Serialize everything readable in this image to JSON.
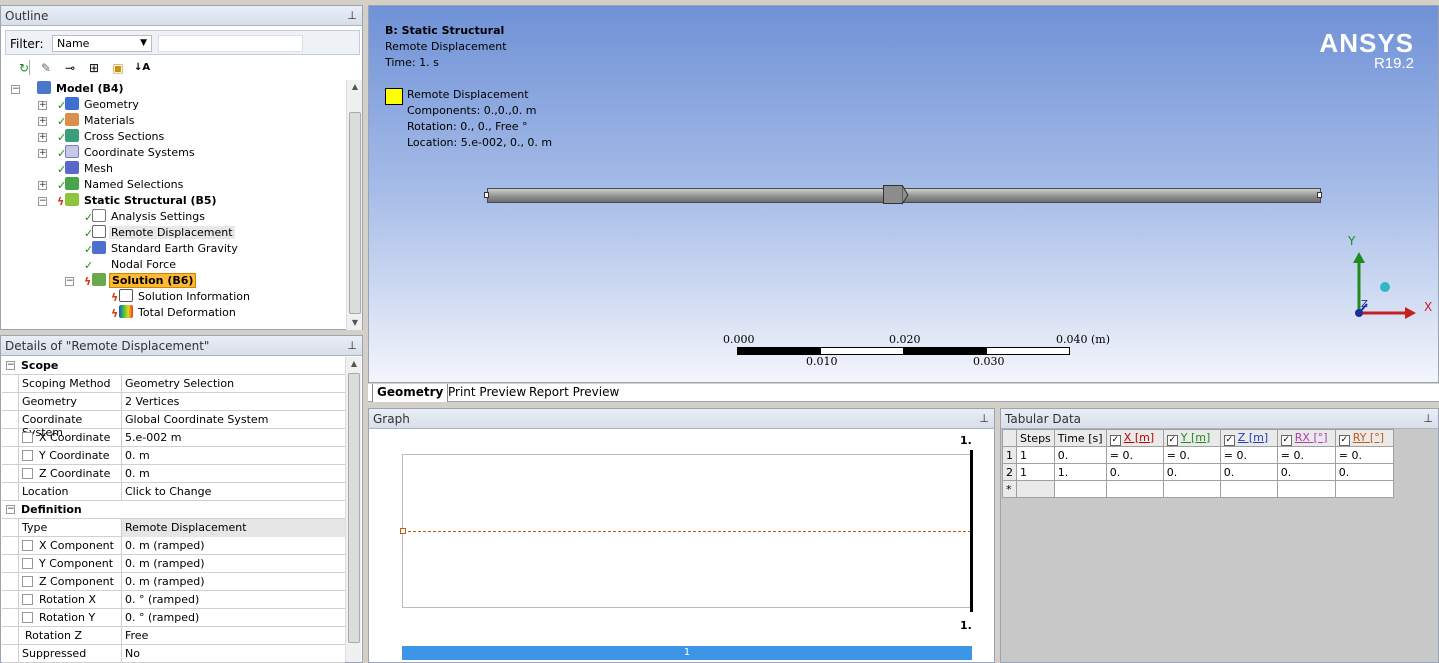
{
  "outline": {
    "title": "Outline",
    "filter_label": "Filter:",
    "filter_value": "Name",
    "tree": {
      "model": "Model (B4)",
      "geometry": "Geometry",
      "materials": "Materials",
      "cross_sections": "Cross Sections",
      "coordinate_systems": "Coordinate Systems",
      "mesh": "Mesh",
      "named_selections": "Named Selections",
      "static_structural": "Static Structural (B5)",
      "analysis_settings": "Analysis Settings",
      "remote_displacement": "Remote Displacement",
      "standard_earth_gravity": "Standard Earth Gravity",
      "nodal_force": "Nodal Force",
      "solution": "Solution (B6)",
      "solution_information": "Solution Information",
      "total_deformation": "Total Deformation"
    }
  },
  "details": {
    "title": "Details of \"Remote Displacement\"",
    "scope_header": "Scope",
    "definition_header": "Definition",
    "rows": {
      "scoping_method": {
        "k": "Scoping Method",
        "v": "Geometry Selection"
      },
      "geometry": {
        "k": "Geometry",
        "v": "2 Vertices"
      },
      "coord_system": {
        "k": "Coordinate System",
        "v": "Global Coordinate System"
      },
      "x_coord": {
        "k": "X Coordinate",
        "v": "5.e-002 m"
      },
      "y_coord": {
        "k": "Y Coordinate",
        "v": "0. m"
      },
      "z_coord": {
        "k": "Z Coordinate",
        "v": "0. m"
      },
      "location": {
        "k": "Location",
        "v": "Click to Change"
      },
      "type": {
        "k": "Type",
        "v": "Remote Displacement"
      },
      "x_comp": {
        "k": "X Component",
        "v": "0. m  (ramped)"
      },
      "y_comp": {
        "k": "Y Component",
        "v": "0. m  (ramped)"
      },
      "z_comp": {
        "k": "Z Component",
        "v": "0. m  (ramped)"
      },
      "rot_x": {
        "k": "Rotation X",
        "v": "0. °  (ramped)"
      },
      "rot_y": {
        "k": "Rotation Y",
        "v": "0. °  (ramped)"
      },
      "rot_z": {
        "k": "Rotation Z",
        "v": "Free"
      },
      "suppressed": {
        "k": "Suppressed",
        "v": "No"
      }
    }
  },
  "viewport": {
    "title": "B: Static Structural",
    "subtitle": "Remote Displacement",
    "time": "Time: 1. s",
    "legend_name": "Remote Displacement",
    "components": "Components: 0.,0.,0. m",
    "rotation": "Rotation: 0., 0., Free °",
    "location": "Location: 5.e-002, 0., 0. m",
    "brand": "ANSYS",
    "version": "R19.2",
    "scale_labels": {
      "s0": "0.000",
      "s1": "0.010",
      "s2": "0.020",
      "s3": "0.030",
      "s4": "0.040 (m)"
    },
    "axis_y": "Y",
    "axis_x": "X",
    "axis_z": "Z",
    "legend_color": "#ffff00"
  },
  "tabs": {
    "geometry": "Geometry",
    "print_preview": "Print Preview",
    "report_preview": "Report Preview"
  },
  "graph": {
    "title": "Graph",
    "top_label": "1.",
    "bottom_label": "1.",
    "timebar_label": "1"
  },
  "tabular": {
    "title": "Tabular Data",
    "headers": {
      "steps": "Steps",
      "time": "Time [s]",
      "x": "X [m]",
      "y": "Y [m]",
      "z": "Z [m]",
      "rx": "RX [°]",
      "ry": "RY [°]"
    },
    "rows": [
      {
        "idx": "1",
        "steps": "1",
        "time": "0.",
        "x": "= 0.",
        "y": "= 0.",
        "z": "= 0.",
        "rx": "= 0.",
        "ry": "= 0."
      },
      {
        "idx": "2",
        "steps": "1",
        "time": "1.",
        "x": "0.",
        "y": "0.",
        "z": "0.",
        "rx": "0.",
        "ry": "0."
      }
    ],
    "new_row": "*"
  }
}
